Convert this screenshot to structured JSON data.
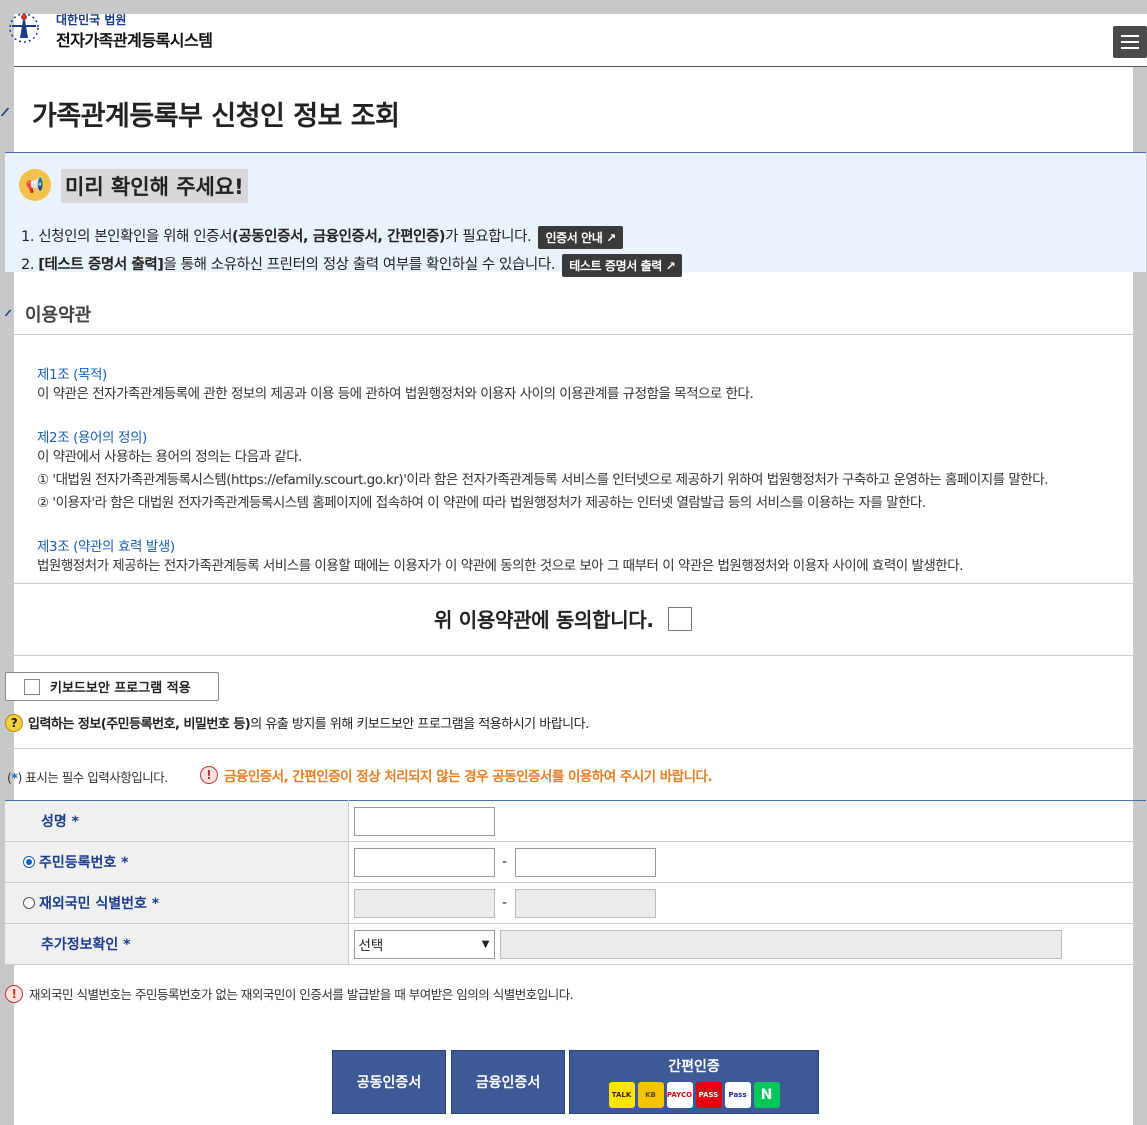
{
  "header": {
    "brand_sub": "대한민국 법원",
    "brand_main": "전자가족관계등록시스템",
    "menu_icon": "hamburger-menu-icon"
  },
  "page_title": "가족관계등록부 신청인 정보 조회",
  "notice": {
    "title": "미리 확인해 주세요!",
    "line1_pre": "1. 신청인의 본인확인을 위해 인증서",
    "line1_bold": "(공동인증서, 금융인증서, 간편인증)",
    "line1_post": "가 필요합니다.",
    "line1_button": "인증서 안내 ↗",
    "line2_pre": "2. ",
    "line2_bold": "[테스트 증명서 출력]",
    "line2_post": "을 통해 소유하신 프린터의 정상 출력 여부를 확인하실 수 있습니다.",
    "line2_button": "테스트 증명서 출력 ↗"
  },
  "terms": {
    "title": "이용약관",
    "art1_title": "제1조 (목적)",
    "art1_text": "이 약관은 전자가족관계등록에 관한 정보의 제공과 이용 등에 관하여 법원행정처와 이용자 사이의 이용관계를 규정함을 목적으로 한다.",
    "art2_title": "제2조 (용어의 정의)",
    "art2_text1": "이 약관에서 사용하는 용어의 정의는 다음과 같다.",
    "art2_text2": "① '대법원 전자가족관계등록시스템(https://efamily.scourt.go.kr)'이라 함은 전자가족관계등록 서비스를 인터넷으로 제공하기 위하여 법원행정처가 구축하고 운영하는 홈페이지를 말한다.",
    "art2_text3": "② '이용자'라 함은 대법원 전자가족관계등록시스템 홈페이지에 접속하여 이 약관에 따라 법원행정처가 제공하는 인터넷 열람발급 등의 서비스를 이용하는 자를 말한다.",
    "art3_title": "제3조 (약관의 효력 발생)",
    "art3_text": "법원행정처가 제공하는 전자가족관계등록 서비스를 이용할 때에는 이용자가 이 약관에 동의한 것으로 보아 그 때부터 이 약관은 법원행정처와 이용자 사이에 효력이 발생한다."
  },
  "agree_label": "위 이용약관에 동의합니다.",
  "keyboard": {
    "button_label": "키보드보안 프로그램 적용",
    "help_bold": "입력하는 정보(주민등록번호, 비밀번호 등)",
    "help_rest": "의 유출 방지를 위해 키보드보안 프로그램을 적용하시기 바랍니다."
  },
  "required_note": "표시는 필수 입력사항입니다.",
  "required_prefix": "(",
  "required_star": "*",
  "required_suffix": ")",
  "warning": "금융인증서, 간편인증이 정상 처리되지 않는 경우 공동인증서를 이용하여 주시기 바랍니다.",
  "form": {
    "name_label": "성명",
    "rrn_label": "주민등록번호",
    "foreign_label": "재외국민 식별번호",
    "extra_label": "추가정보확인",
    "star": "*",
    "dash": "-",
    "extra_select": "선택"
  },
  "foot_note": "재외국민 식별번호는 주민등록번호가 없는 재외국민이 인증서를 발급받을 때 부여받은 임의의 식별번호입니다.",
  "cert": {
    "common": "공동인증서",
    "financial": "금융인증서",
    "simple": "간편인증",
    "icons": [
      "TALK",
      "KB",
      "PAYCO",
      "PASS",
      "Pass",
      "N"
    ]
  }
}
